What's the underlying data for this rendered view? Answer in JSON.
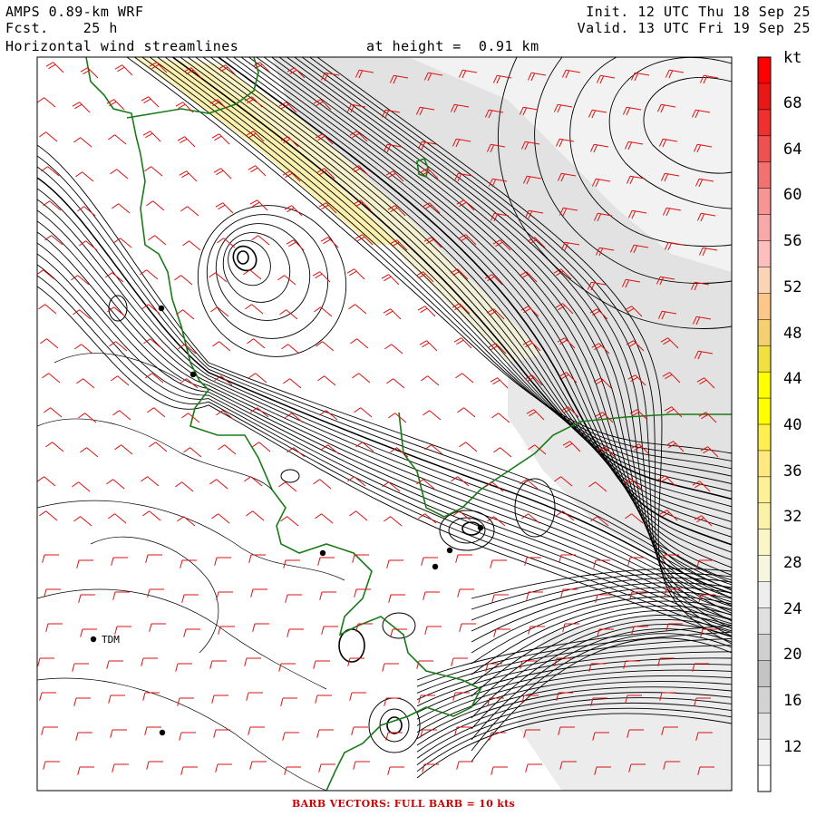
{
  "header": {
    "model": "AMPS 0.89-km WRF",
    "forecast": "Fcst.    25 h",
    "field": "Horizontal wind streamlines",
    "height": "at height =  0.91 km",
    "init": "Init. 12 UTC Thu 18 Sep 25",
    "valid": "Valid. 13 UTC Fri 19 Sep 25"
  },
  "colorbar": {
    "unit": "kt",
    "labels": [
      "68",
      "64",
      "60",
      "56",
      "52",
      "48",
      "44",
      "40",
      "36",
      "32",
      "28",
      "24",
      "20",
      "16",
      "12"
    ],
    "colors": [
      "#ffffff",
      "#f2f2f2",
      "#e4e4e4",
      "#d2d2d2",
      "#c4c4c4",
      "#d0d0d0",
      "#e0e0e0",
      "#eeeeee",
      "#f7f7e0",
      "#fbf6c8",
      "#fbf2aa",
      "#fdf096",
      "#ffe980",
      "#ffef50",
      "#ffff00",
      "#ffff00",
      "#f0e040",
      "#f5d070",
      "#fbc889",
      "#fbd3b5",
      "#fbbfbf",
      "#f7a9a9",
      "#f59595",
      "#f27272",
      "#ef5050",
      "#ef3030",
      "#e81818",
      "#ff0000"
    ]
  },
  "map": {
    "station_label": "TDM",
    "land_fill": "#ffffff",
    "coast_color": "#1a7a1a",
    "barb_color": "#dd1111",
    "streamline_color": "#000000"
  },
  "footer": {
    "text": "BARB VECTORS:  FULL BARB = 10 kts"
  }
}
